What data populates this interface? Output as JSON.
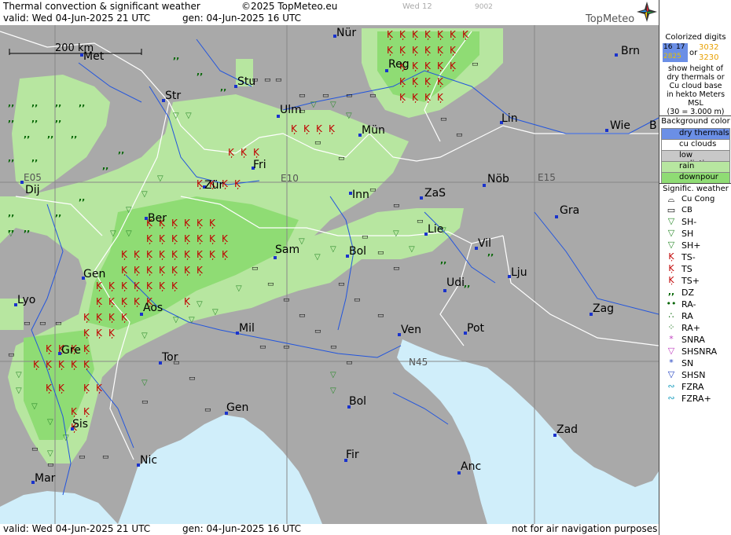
{
  "header": {
    "title": "Thermal convection & significant weather",
    "copyright": "©2025 TopMeteo.eu",
    "valid": "valid:  Wed  04-Jun-2025  21 UTC",
    "gen": "gen: 04-Jun-2025 16 UTC",
    "faint1": "Wed 12",
    "faint2": "9002",
    "brand": "TopMeteo"
  },
  "footer": {
    "valid": "valid:  Wed  04-Jun-2025  21 UTC",
    "gen": "gen: 04-Jun-2025 16 UTC",
    "note": "not for air navigation purposes"
  },
  "scale": {
    "label": "200 km"
  },
  "grid_labels": [
    "E05",
    "E10",
    "E15",
    "N45"
  ],
  "cities": [
    "Nür",
    "Brn",
    "Met",
    "Reg",
    "Stu",
    "Str",
    "Ulm",
    "Lin",
    "Wie",
    "B",
    "Mün",
    "Fri",
    "Dij",
    "Zür",
    "Inn",
    "ZaS",
    "Nöb",
    "Gra",
    "Ber",
    "Lie",
    "Sam",
    "Vil",
    "Bol",
    "Gen",
    "Lju",
    "Udi",
    "Lyo",
    "Aos",
    "Zag",
    "Mil",
    "Ven",
    "Pot",
    "Gre",
    "Tor",
    "Bol",
    "Gen",
    "Zad",
    "Sis",
    "Nic",
    "Fir",
    "Anc",
    "Mar"
  ],
  "legend": {
    "digits_title": "Colorized digits",
    "digits_a1": "16",
    "digits_a2": "17",
    "digits_b": "2825",
    "or": "or",
    "digits_c1": "3032",
    "digits_c2": "3230",
    "digits_desc": [
      "show height of",
      "dry thermals or",
      "Cu cloud base",
      "in hekto Meters",
      "MSL",
      "(30 = 3.000 m)"
    ],
    "bg_title": "Background color",
    "bg_items": [
      {
        "label": "dry thermals",
        "color": "#6b8fe6"
      },
      {
        "label": "cu clouds",
        "color": "#ffffff"
      },
      {
        "label": "low radiation",
        "color": "#c8c8c8"
      },
      {
        "label": "rain",
        "color": "#b7e6a0"
      },
      {
        "label": "downpour",
        "color": "#8fdc74"
      }
    ],
    "wx_title": "Signific. weather",
    "wx_items": [
      {
        "label": "Cu Cong",
        "icon": "cu-cong-icon",
        "glyph": "⌓",
        "color": "#000"
      },
      {
        "label": "CB",
        "icon": "cb-icon",
        "glyph": "▭",
        "color": "#000"
      },
      {
        "label": "SH-",
        "icon": "shower-light-icon",
        "glyph": "▽",
        "color": "#2c8a2c"
      },
      {
        "label": "SH",
        "icon": "shower-icon",
        "glyph": "▽",
        "color": "#2c8a2c"
      },
      {
        "label": "SH+",
        "icon": "shower-heavy-icon",
        "glyph": "▽",
        "color": "#2c8a2c"
      },
      {
        "label": "TS-",
        "icon": "thunderstorm-light-icon",
        "glyph": "K",
        "color": "#c00000"
      },
      {
        "label": "TS",
        "icon": "thunderstorm-icon",
        "glyph": "K",
        "color": "#c00000"
      },
      {
        "label": "TS+",
        "icon": "thunderstorm-heavy-icon",
        "glyph": "K",
        "color": "#c00000"
      },
      {
        "label": "DZ",
        "icon": "drizzle-icon",
        "glyph": ",,",
        "color": "#006400"
      },
      {
        "label": "RA-",
        "icon": "rain-light-icon",
        "glyph": "••",
        "color": "#006400"
      },
      {
        "label": "RA",
        "icon": "rain-icon",
        "glyph": "∴",
        "color": "#006400"
      },
      {
        "label": "RA+",
        "icon": "rain-heavy-icon",
        "glyph": "⁘",
        "color": "#006400"
      },
      {
        "label": "SNRA",
        "icon": "snow-rain-icon",
        "glyph": "*",
        "color": "#c040c0"
      },
      {
        "label": "SHSNRA",
        "icon": "shower-snow-rain-icon",
        "glyph": "▽",
        "color": "#c040c0"
      },
      {
        "label": "SN",
        "icon": "snow-icon",
        "glyph": "*",
        "color": "#2040c0"
      },
      {
        "label": "SHSN",
        "icon": "shower-snow-icon",
        "glyph": "▽",
        "color": "#2040c0"
      },
      {
        "label": "FZRA",
        "icon": "freezing-rain-icon",
        "glyph": "∾",
        "color": "#20a0c0"
      },
      {
        "label": "FZRA+",
        "icon": "freezing-rain-heavy-icon",
        "glyph": "∾",
        "color": "#20a0c0"
      }
    ]
  },
  "colors": {
    "land": "#a9a9a9",
    "sea": "#d0eefa",
    "rain": "#b7e6a0",
    "downpour": "#8fdc74",
    "river": "#2255dd",
    "city": "#1a33cc",
    "ts": "#c00000",
    "sh": "#2c8a2c"
  }
}
